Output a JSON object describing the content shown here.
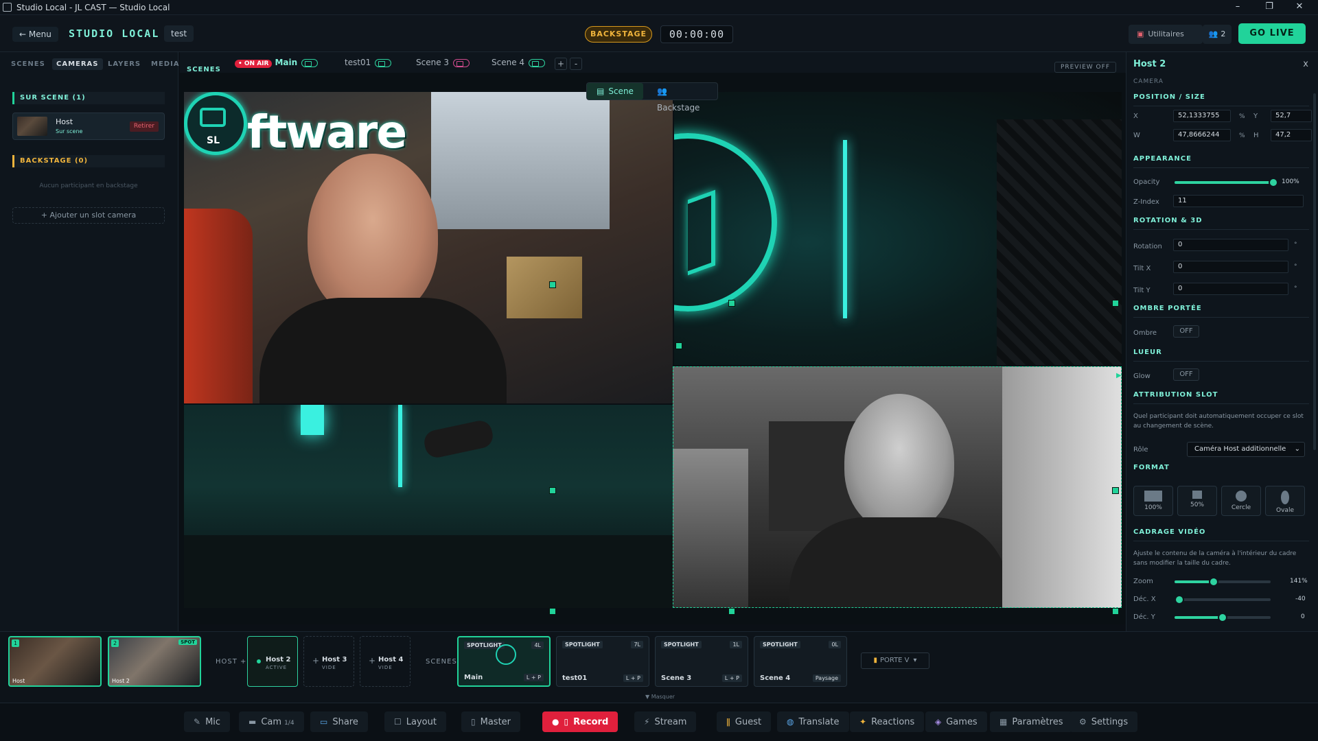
{
  "window": {
    "title": "Studio Local - JL CAST — Studio Local"
  },
  "topbar": {
    "menu_label": "← Menu",
    "brand": "STUDIO LOCAL",
    "session": "test",
    "backstage": "BACKSTAGE",
    "timer": "00:00:00",
    "utilitaires": "Utilitaires",
    "guests": "2",
    "golive": "GO LIVE"
  },
  "leftpanel": {
    "tabs": [
      "SCENES",
      "CAMERAS",
      "LAYERS",
      "MEDIA"
    ],
    "active_tab": "CAMERAS",
    "on_scene_head": "SUR SCENE (1)",
    "host_name": "Host",
    "host_status": "Sur scene",
    "retirer": "Retirer",
    "backstage_head": "BACKSTAGE (0)",
    "backstage_empty": "Aucun participant en backstage",
    "add_slot": "+ Ajouter un slot camera"
  },
  "scenebar": {
    "label": "SCENES",
    "onair": "• ON AIR",
    "tabs": [
      "Main",
      "test01",
      "Scene 3",
      "Scene 4"
    ],
    "plus": "+",
    "minus": "-",
    "preview": "PREVIEW OFF"
  },
  "canvas": {
    "tab_scene": "Scene",
    "tab_backstage": "Backstage",
    "logo_text": "ftware",
    "logo_badge": "SL"
  },
  "rightpanel": {
    "title": "Host 2",
    "close": "x",
    "subtitle": "CAMERA",
    "position_head": "POSITION / SIZE",
    "x_label": "X",
    "x_value": "52,1333755",
    "y_label": "Y",
    "y_value": "52,7",
    "w_label": "W",
    "w_value": "47,8666244",
    "h_label": "H",
    "h_value": "47,2",
    "pct": "%",
    "appearance_head": "APPEARANCE",
    "opacity_label": "Opacity",
    "opacity_value": "100%",
    "opacity_level": 1.0,
    "zindex_label": "Z-Index",
    "zindex_value": "11",
    "rotation_head": "ROTATION & 3D",
    "rotation_label": "Rotation",
    "rotation_value": "0",
    "tiltx_label": "Tilt X",
    "tiltx_value": "0",
    "tilty_label": "Tilt Y",
    "tilty_value": "0",
    "deg": "°",
    "shadow_head": "OMBRE PORTÉE",
    "shadow_label": "Ombre",
    "shadow_value": "OFF",
    "glow_head": "LUEUR",
    "glow_label": "Glow",
    "glow_value": "OFF",
    "slot_head": "ATTRIBUTION SLOT",
    "slot_desc": "Quel participant doit automatiquement occuper ce slot au changement de scène.",
    "role_label": "Rôle",
    "role_value": "Caméra Host additionnelle",
    "format_head": "FORMAT",
    "formats": [
      "100%",
      "50%",
      "Cercle",
      "Ovale"
    ],
    "crop_head": "CADRAGE VIDÉO",
    "crop_desc": "Ajuste le contenu de la caméra à l'intérieur du cadre sans modifier la taille du cadre.",
    "zoom_label": "Zoom",
    "zoom_value": "141%",
    "zoom_level": 0.41,
    "decx_label": "Déc. X",
    "decx_value": "-40",
    "decx_level": 0.05,
    "decy_label": "Déc. Y",
    "decy_value": "0",
    "decy_level": 0.5
  },
  "bottomstrip": {
    "thumbs": [
      {
        "num": "1",
        "name": "Host"
      },
      {
        "num": "2",
        "name": "Host 2",
        "spot": "SPOT"
      }
    ],
    "host_plus": "HOST +",
    "slots": [
      {
        "title": "Host 2",
        "status": "ACTIVE"
      },
      {
        "title": "Host 3",
        "status": "VIDE"
      },
      {
        "title": "Host 4",
        "status": "VIDE"
      }
    ],
    "scenes_label": "SCENES",
    "scene_cards": [
      {
        "badge": "SPOTLIGHT",
        "count": "4L",
        "name": "Main",
        "layout": "L + P"
      },
      {
        "badge": "SPOTLIGHT",
        "count": "7L",
        "name": "test01",
        "layout": "L + P"
      },
      {
        "badge": "SPOTLIGHT",
        "count": "1L",
        "name": "Scene 3",
        "layout": "L + P"
      },
      {
        "badge": "SPOTLIGHT",
        "count": "0L",
        "name": "Scene 4",
        "layout": "Paysage"
      }
    ],
    "porte": "PORTE V",
    "masquer": "▼ Masquer"
  },
  "toolbar": {
    "mic": "Mic",
    "cam": "Cam",
    "cam_badge": "1/4",
    "share": "Share",
    "layout": "Layout",
    "master": "Master",
    "record": "Record",
    "stream": "Stream",
    "guest": "Guest",
    "translate": "Translate",
    "reactions": "Reactions",
    "games": "Games",
    "parametres": "Paramètres",
    "settings": "Settings"
  },
  "colors": {
    "accent": "#21d39a",
    "onair": "#e0203c",
    "backstage": "#f0b43c"
  }
}
